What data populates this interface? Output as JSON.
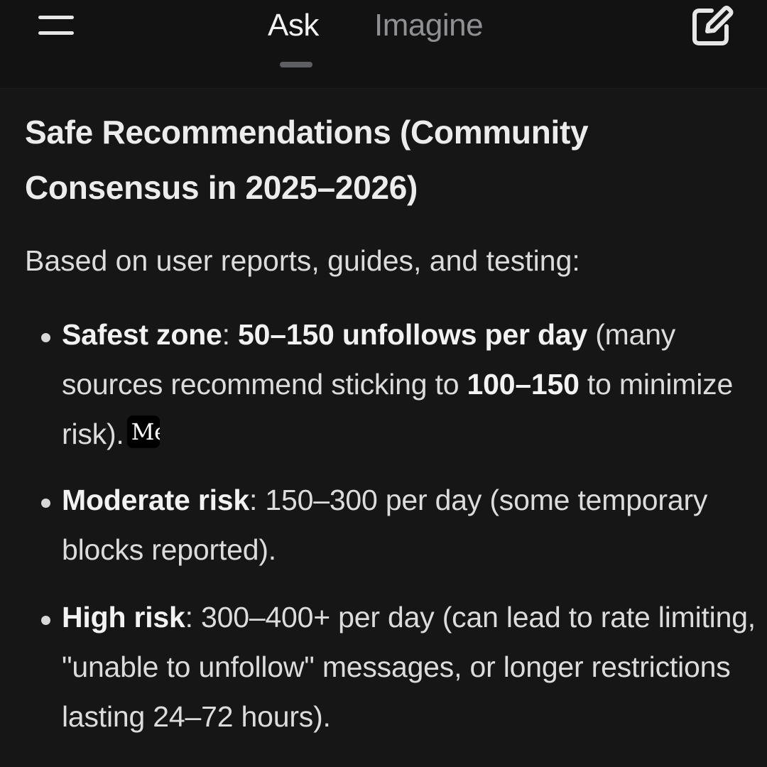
{
  "header": {
    "menu_icon": "hamburger-menu-icon",
    "tabs": [
      {
        "label": "Ask",
        "active": true
      },
      {
        "label": "Imagine",
        "active": false
      }
    ],
    "new_chat_icon": "edit-square-icon"
  },
  "response": {
    "heading_line1": "Safe Recommendations (Community",
    "heading_line2": "Consensus in 2025–2026)",
    "intro": "Based on user reports, guides, and testing:",
    "bullets": [
      {
        "label": "Safest zone",
        "colon": ": ",
        "bold_range": "50–150 unfollows per day",
        "text_1": " (many sources recommend sticking to ",
        "bold_2": "100–150",
        "text_2": " to minimize risk).",
        "citation": "Me",
        "citation_icon": "medium-logo-icon"
      },
      {
        "label": "Moderate risk",
        "colon": ": ",
        "text": "150–300 per day (some temporary blocks reported)."
      },
      {
        "label": "High risk",
        "colon": ": ",
        "text": "300–400+ per day (can lead to rate limiting, \"unable to unfollow\" messages, or longer restrictions lasting 24–72 hours)."
      }
    ]
  },
  "colors": {
    "background": "#161617",
    "header_background": "#121213",
    "text_primary": "#ececed",
    "text_inactive_tab": "#8f9094"
  }
}
